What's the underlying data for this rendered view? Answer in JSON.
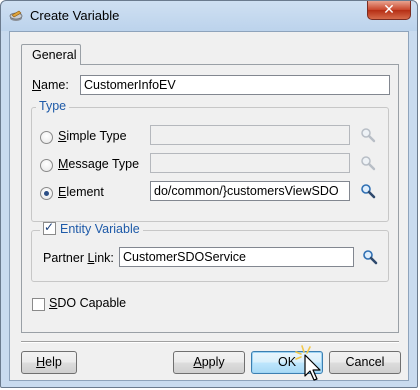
{
  "window": {
    "title": "Create Variable",
    "close_glyph": "✕"
  },
  "tabs": [
    {
      "label": "General"
    }
  ],
  "name": {
    "label_prefix": "",
    "mnemonic": "N",
    "label_rest": "ame:",
    "value": "CustomerInfoEV"
  },
  "type_group": {
    "title": "Type",
    "simple": {
      "mnemonic": "S",
      "label_rest": "imple Type",
      "value": "",
      "checked": false
    },
    "message": {
      "mnemonic": "M",
      "label_rest": "essage Type",
      "value": "",
      "checked": false
    },
    "element": {
      "mnemonic": "E",
      "label_rest": "lement",
      "value": "do/common/}customersViewSDO",
      "checked": true
    }
  },
  "entity_group": {
    "title": "Entity Variable",
    "checked": true,
    "partner_label_prefix": "Partner ",
    "partner_mnemonic": "L",
    "partner_label_rest": "ink:",
    "partner_value": "CustomerSDOService"
  },
  "sdo": {
    "mnemonic": "S",
    "label_rest": "DO Capable",
    "checked": false
  },
  "buttons": {
    "help": {
      "mnemonic": "H",
      "rest": "elp"
    },
    "apply": {
      "mnemonic": "A",
      "prefix": "",
      "rest": "pply",
      "underline_char": "p"
    },
    "ok": {
      "label": "OK"
    },
    "cancel": {
      "label": "Cancel"
    }
  },
  "colors": {
    "group_title": "#1e5aa8",
    "close_button": "#c8452a",
    "titlebar": "#bcd3ec"
  },
  "icons": {
    "title": "variable-icon",
    "search": "magnifier-icon",
    "cursor": "arrow-cursor-icon"
  }
}
